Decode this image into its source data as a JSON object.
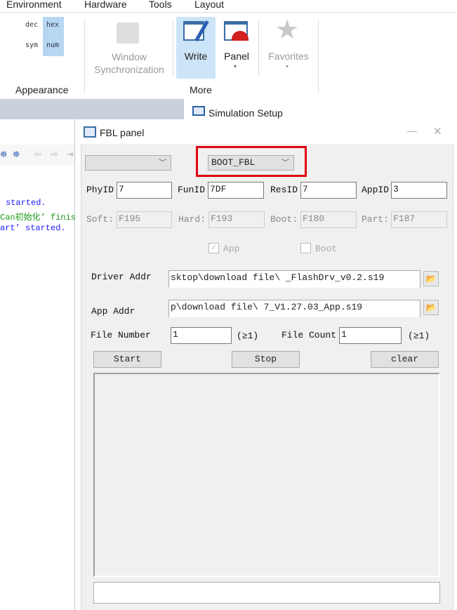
{
  "menu": [
    "Environment",
    "Hardware",
    "Tools",
    "Layout"
  ],
  "ribbon": {
    "appearance": {
      "dec": "dec",
      "hex": "hex",
      "sym": "sym",
      "num": "num",
      "group": "Appearance"
    },
    "window_sync": "Window\nSynchronization",
    "write": "Write",
    "panel": "Panel",
    "favorites": "Favorites",
    "more_group": "More"
  },
  "tab": {
    "label": "Simulation Setup"
  },
  "log": [
    "started.",
    "Can初始化’ finis",
    "art’ started."
  ],
  "fbl": {
    "title": "FBL panel",
    "channel": "",
    "mode": "BOOT_FBL",
    "phyid_label": "PhyID",
    "phyid": "7",
    "funid_label": "FunID",
    "funid": "7DF",
    "resid_label": "ResID",
    "resid": "7",
    "appid_label": "AppID",
    "appid": "3",
    "soft_label": "Soft:",
    "soft": "F195",
    "hard_label": "Hard:",
    "hard": "F193",
    "boot_label": "Boot:",
    "boot": "F180",
    "part_label": "Part:",
    "part": "F187",
    "app_check": "App",
    "app_checked": true,
    "boot_check": "Boot",
    "boot_checked": false,
    "driver_label": "Driver Addr",
    "driver": "sktop\\download file\\      _FlashDrv_v0.2.s19",
    "app_label": "App Addr",
    "app": "p\\download file\\          7_V1.27.03_App.s19",
    "file_number_label": "File Number",
    "file_number": "1",
    "file_number_hint": "(≥1)",
    "file_count_label": "File Count",
    "file_count": "1",
    "file_count_hint": "(≥1)",
    "start": "Start",
    "stop": "Stop",
    "clear": "clear",
    "status": ""
  },
  "colors": {
    "highlight": "#e0000f",
    "selected": "#cce4f7"
  }
}
